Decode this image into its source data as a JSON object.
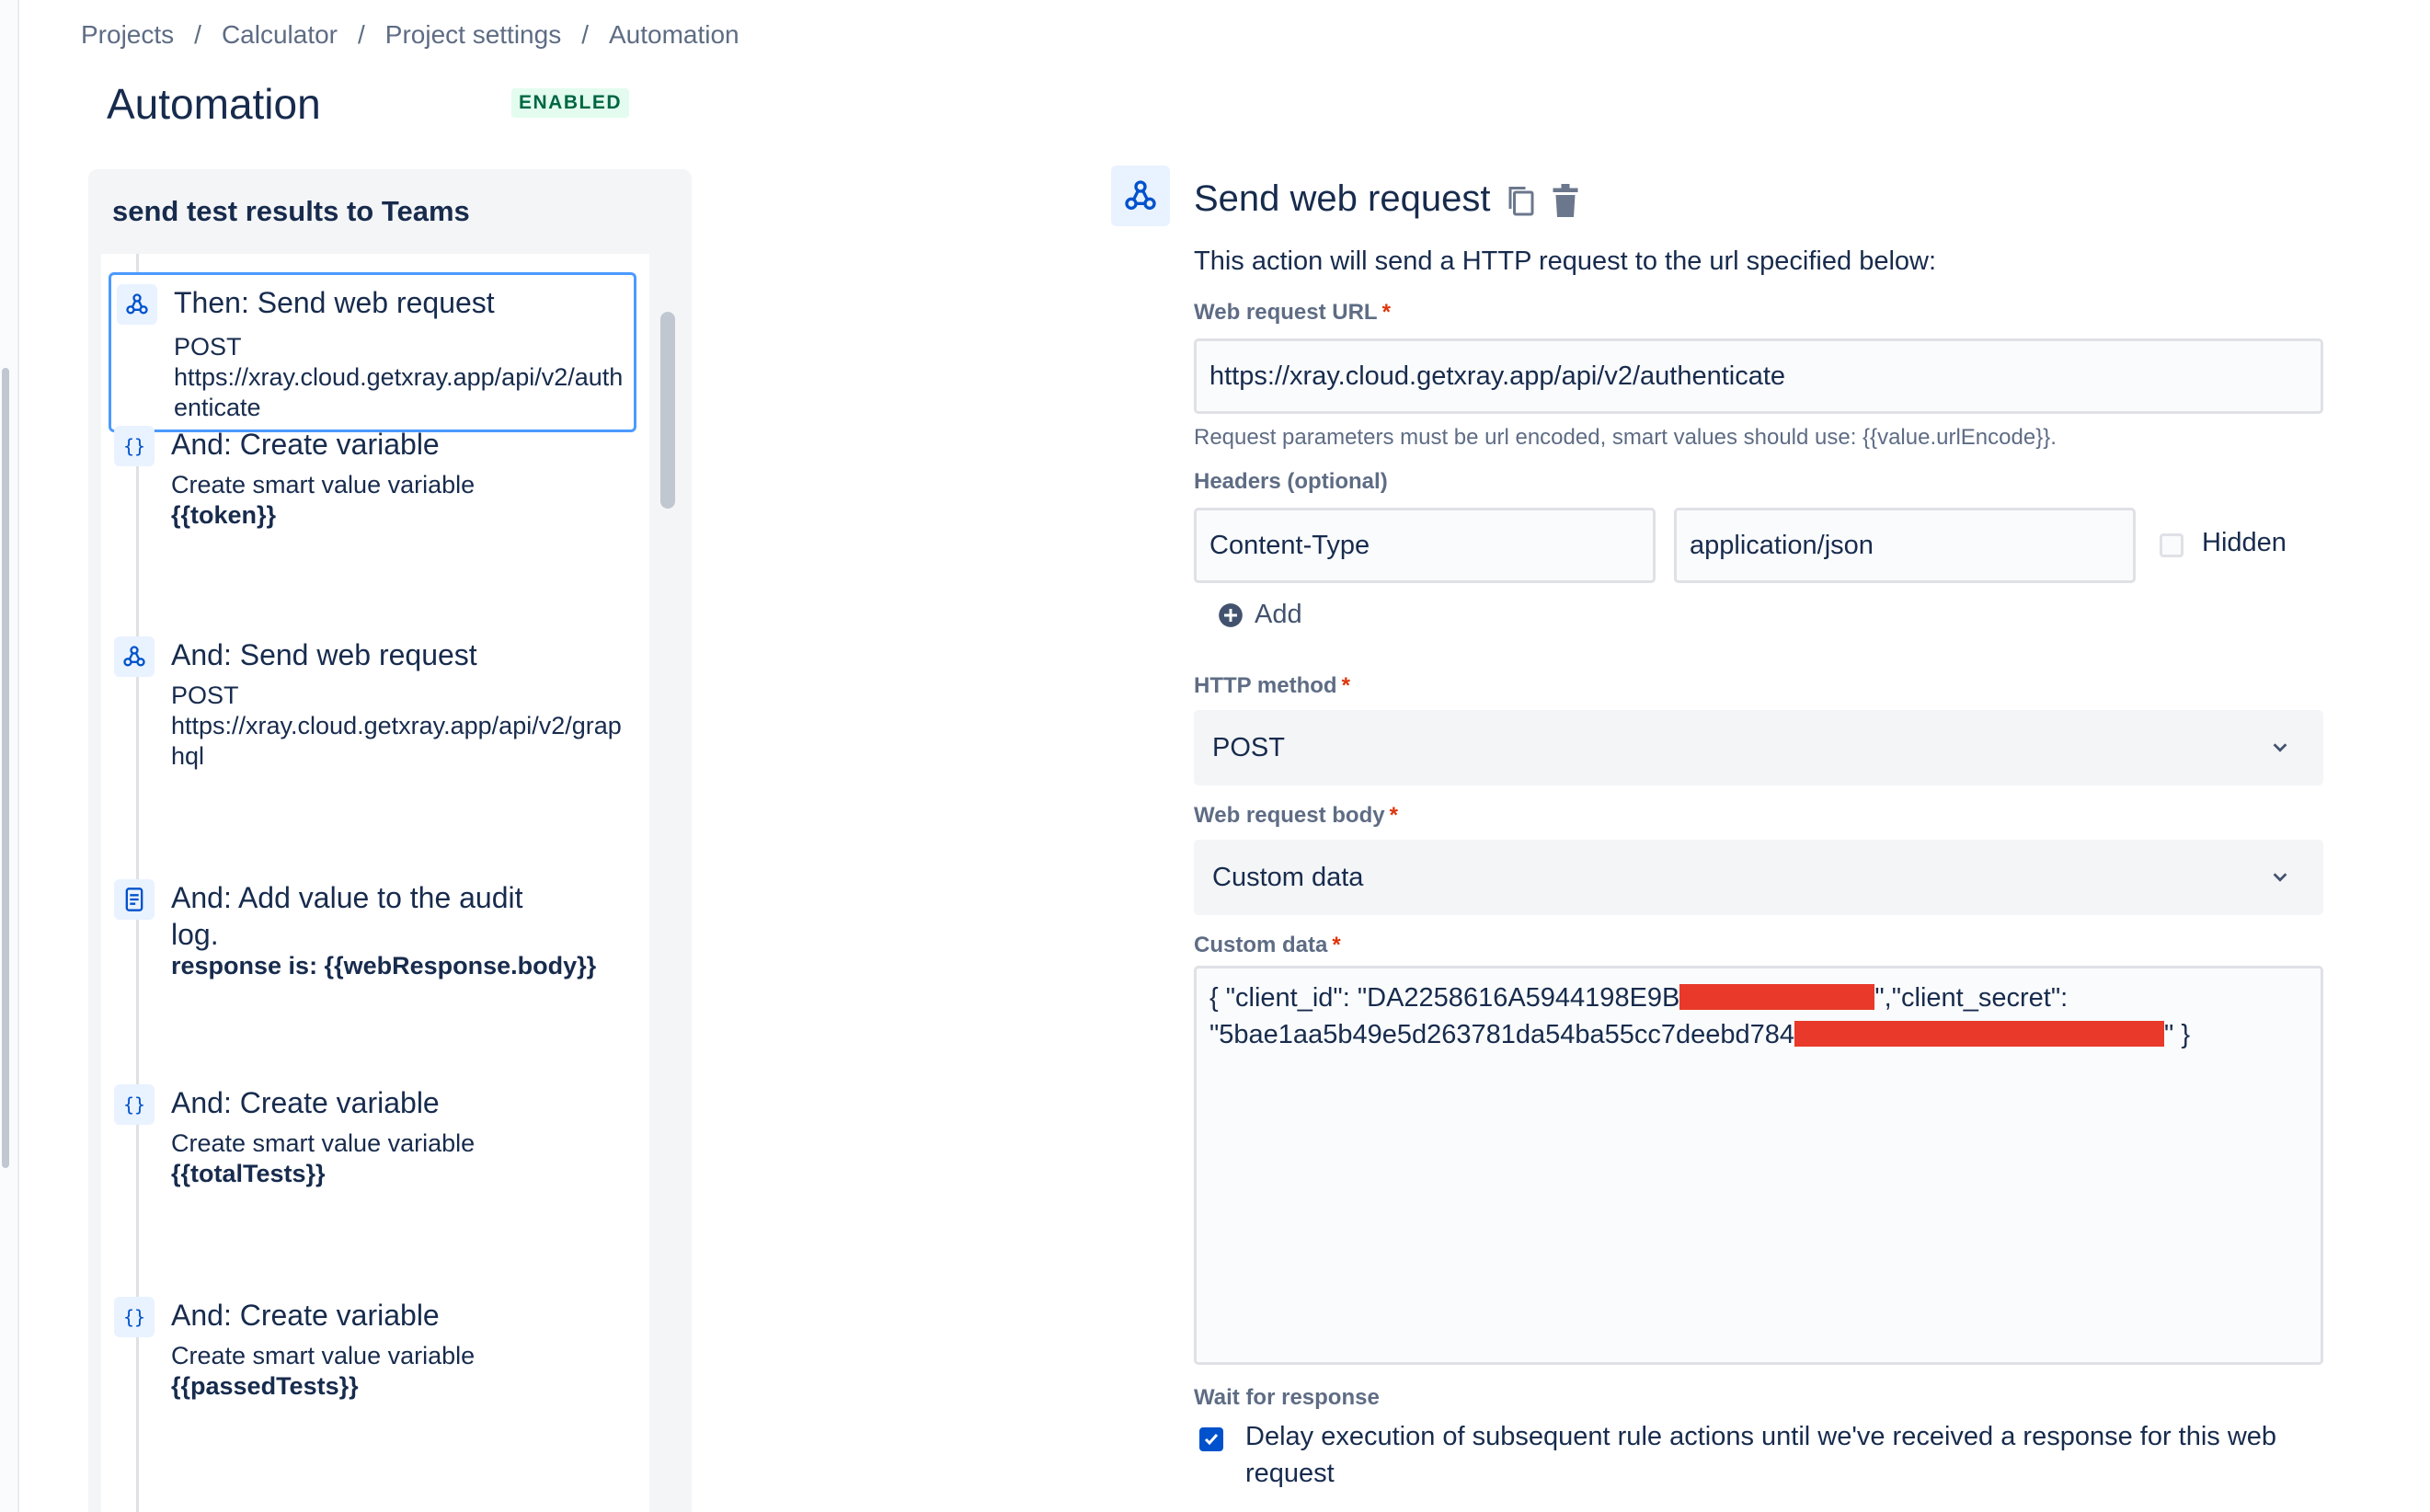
{
  "breadcrumb": [
    "Projects",
    "Calculator",
    "Project settings",
    "Automation"
  ],
  "page": {
    "title": "Automation",
    "status_badge": "ENABLED"
  },
  "rule": {
    "name": "send test results to Teams",
    "items": [
      {
        "title": "Then: Send web request",
        "desc_line1": "POST",
        "desc_line2": "https://xray.cloud.getxray.app/api/v2/authenticate",
        "icon": "webhook-icon"
      },
      {
        "title": "And: Create variable",
        "desc_line1": "Create smart value variable",
        "desc_bold": "{{token}}",
        "icon": "braces-icon"
      },
      {
        "title": "And: Send web request",
        "desc_line1": "POST",
        "desc_line2": "https://xray.cloud.getxray.app/api/v2/graphql",
        "icon": "webhook-icon"
      },
      {
        "title": "And: Add value to the audit log.",
        "desc_bold": "response is: {{webResponse.body}}",
        "icon": "document-icon"
      },
      {
        "title": "And: Create variable",
        "desc_line1": "Create smart value variable",
        "desc_bold": "{{totalTests}}",
        "icon": "braces-icon"
      },
      {
        "title": "And: Create variable",
        "desc_line1": "Create smart value variable",
        "desc_bold": "{{passedTests}}",
        "icon": "braces-icon"
      }
    ]
  },
  "action": {
    "title": "Send web request",
    "intro": "This action will send a HTTP request to the url specified below:",
    "url_label": "Web request URL",
    "url_value": "https://xray.cloud.getxray.app/api/v2/authenticate",
    "url_hint": "Request parameters must be url encoded, smart values should use: {{value.urlEncode}}.",
    "headers_label": "Headers (optional)",
    "header_key": "Content-Type",
    "header_value": "application/json",
    "hidden_label": "Hidden",
    "add_label": "Add",
    "method_label": "HTTP method",
    "method_value": "POST",
    "body_label": "Web request body",
    "body_value": "Custom data",
    "custom_label": "Custom data",
    "custom_line1_a": "{ \"client_id\": \"DA2258616A5944198E9B",
    "custom_line1_b": "\",\"client_secret\":",
    "custom_line2_a": "\"5bae1aa5b49e5d263781da54ba55cc7deebd784",
    "custom_line2_b": "\" }",
    "wait_label": "Wait for response",
    "wait_text": "Delay execution of subsequent rule actions until we've received a response for this web request",
    "wait_checked": true,
    "accent_color": "#0052cc",
    "redaction_color": "#e8392a"
  }
}
